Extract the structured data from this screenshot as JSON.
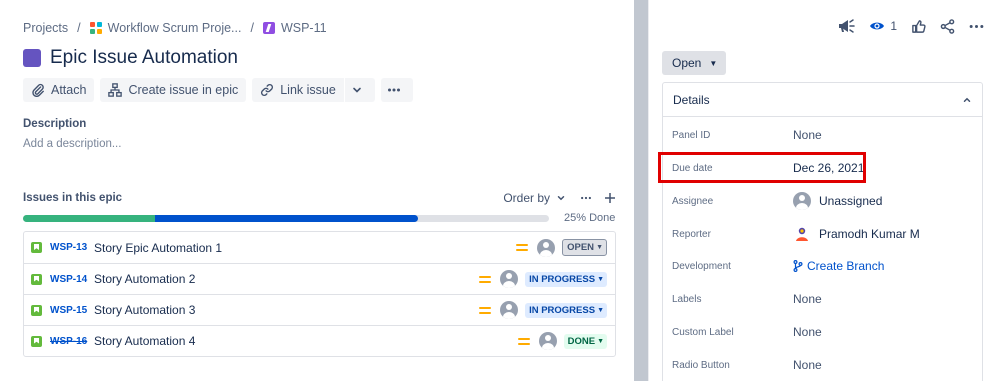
{
  "breadcrumb": {
    "projects": "Projects",
    "separator": "/",
    "project_name": "Workflow Scrum Proje...",
    "issue_key": "WSP-11"
  },
  "epic": {
    "title": "Epic Issue Automation",
    "color": "#6554c0"
  },
  "toolbar": {
    "attach": "Attach",
    "create_issue_in_epic": "Create issue in epic",
    "link_issue": "Link issue"
  },
  "description": {
    "label": "Description",
    "placeholder": "Add a description..."
  },
  "issues_in_epic": {
    "title": "Issues in this epic",
    "order_by": "Order by",
    "progress_done_fraction": 0.25,
    "progress_in_progress_fraction": 0.5,
    "progress_label": "25% Done",
    "issues": [
      {
        "key": "WSP-13",
        "summary": "Story Epic Automation 1",
        "status": "OPEN",
        "done": false
      },
      {
        "key": "WSP-14",
        "summary": "Story Automation 2",
        "status": "IN PROGRESS",
        "done": false
      },
      {
        "key": "WSP-15",
        "summary": "Story Automation 3",
        "status": "IN PROGRESS",
        "done": false
      },
      {
        "key": "WSP-16",
        "summary": "Story Automation 4",
        "status": "DONE",
        "done": true
      }
    ]
  },
  "header_actions": {
    "watch_count": "1"
  },
  "status_button": {
    "label": "Open"
  },
  "details": {
    "title": "Details",
    "fields": {
      "panel_id": {
        "label": "Panel ID",
        "value": "None"
      },
      "due_date": {
        "label": "Due date",
        "value": "Dec 26, 2021"
      },
      "assignee": {
        "label": "Assignee",
        "value": "Unassigned"
      },
      "reporter": {
        "label": "Reporter",
        "value": "Pramodh Kumar M"
      },
      "development": {
        "label": "Development",
        "value": "Create Branch"
      },
      "labels": {
        "label": "Labels",
        "value": "None"
      },
      "custom_label": {
        "label": "Custom Label",
        "value": "None"
      },
      "radio_button": {
        "label": "Radio Button",
        "value": "None"
      }
    }
  },
  "colors": {
    "link": "#0052cc",
    "done_green": "#36b37e",
    "in_progress_blue": "#0052cc",
    "highlight_red": "#e00000",
    "story_green": "#63ba3c",
    "priority_medium": "#ffab00"
  }
}
